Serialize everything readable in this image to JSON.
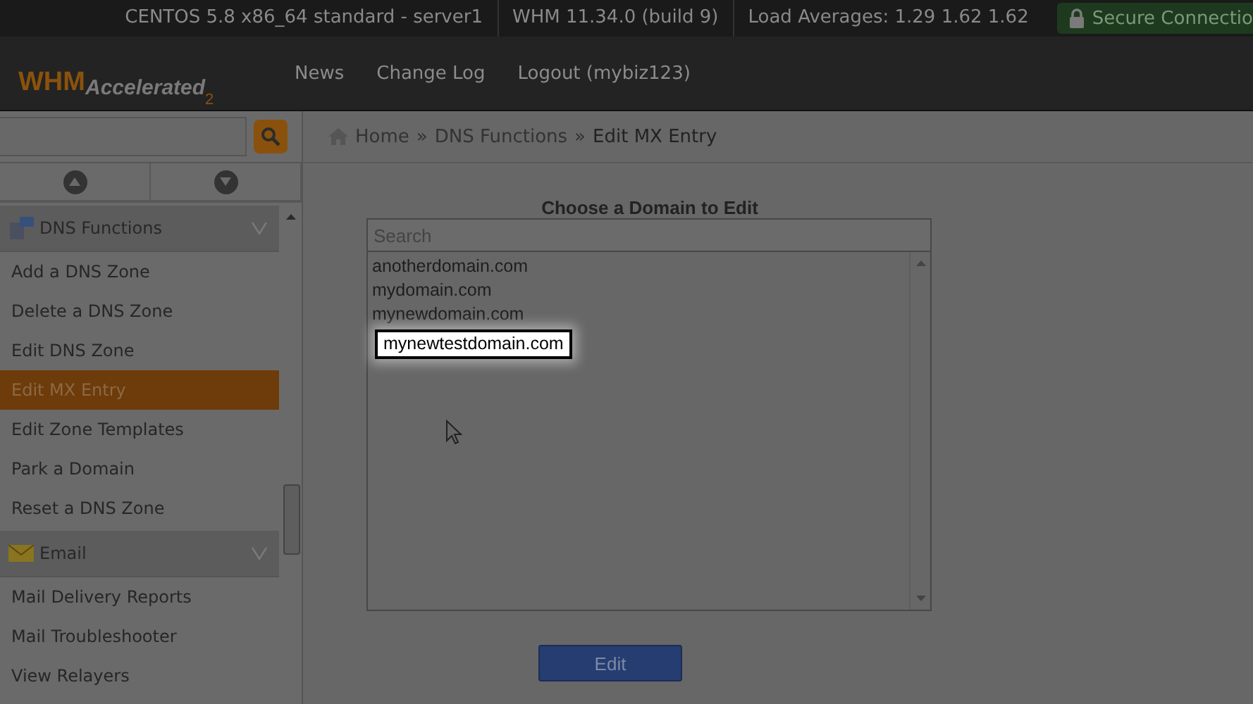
{
  "top_bar": {
    "items": [
      "CENTOS 5.8 x86_64 standard - server1",
      "WHM 11.34.0 (build 9)",
      "Load Averages: 1.29 1.62 1.62"
    ],
    "secure": "Secure Connectio"
  },
  "header": {
    "logo": {
      "main": "WHM",
      "sub": "Accelerated",
      "version": "2"
    },
    "nav": [
      "News",
      "Change Log",
      "Logout (mybiz123)"
    ]
  },
  "sidebar": {
    "groups": [
      {
        "label": "DNS Functions",
        "kind": "dns",
        "expanded": true,
        "items": [
          {
            "label": "Add a DNS Zone",
            "selected": false
          },
          {
            "label": "Delete a DNS Zone",
            "selected": false
          },
          {
            "label": "Edit DNS Zone",
            "selected": false
          },
          {
            "label": "Edit MX Entry",
            "selected": true
          },
          {
            "label": "Edit Zone Templates",
            "selected": false
          },
          {
            "label": "Park a Domain",
            "selected": false
          },
          {
            "label": "Reset a DNS Zone",
            "selected": false
          }
        ]
      },
      {
        "label": "Email",
        "kind": "email",
        "expanded": true,
        "items": [
          {
            "label": "Mail Delivery Reports",
            "selected": false
          },
          {
            "label": "Mail Troubleshooter",
            "selected": false
          },
          {
            "label": "View Relayers",
            "selected": false
          }
        ]
      }
    ]
  },
  "breadcrumb": {
    "items": [
      "Home",
      "DNS Functions",
      "Edit MX Entry"
    ],
    "separators": [
      "»",
      "»"
    ]
  },
  "main": {
    "title": "Choose a Domain to Edit",
    "search": {
      "placeholder": "Search"
    },
    "domains": [
      {
        "label": "anotherdomain.com",
        "selected": false
      },
      {
        "label": "mydomain.com",
        "selected": false
      },
      {
        "label": "mynewdomain.com",
        "selected": false
      },
      {
        "label": "mynewtestdomain.com",
        "selected": true
      }
    ],
    "button": "Edit"
  }
}
